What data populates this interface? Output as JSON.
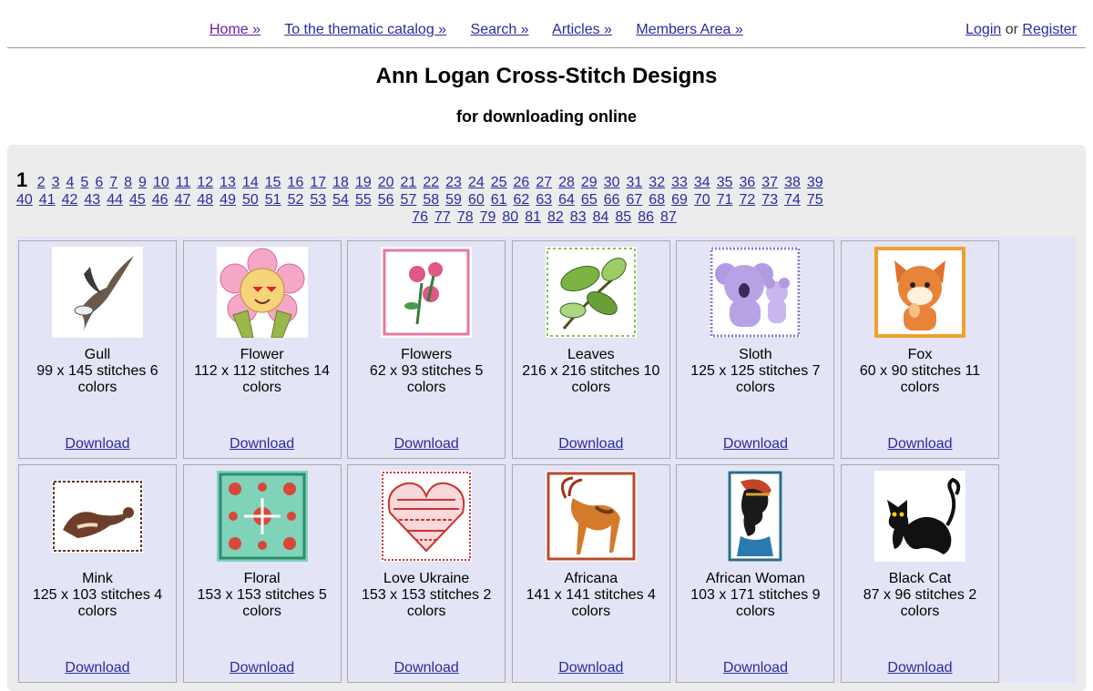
{
  "nav": {
    "home": "Home »",
    "catalog": "To the thematic catalog »",
    "search": "Search »",
    "articles": "Articles »",
    "members": "Members Area »",
    "login": "Login",
    "or": "or",
    "register": "Register"
  },
  "header": {
    "title": "Ann Logan Cross-Stitch Designs",
    "subtitle": "for downloading online"
  },
  "pager": {
    "current": "1",
    "pages_row1": [
      "2",
      "3",
      "4",
      "5",
      "6",
      "7",
      "8",
      "9",
      "10",
      "11",
      "12",
      "13",
      "14",
      "15",
      "16",
      "17",
      "18",
      "19",
      "20",
      "21",
      "22",
      "23",
      "24",
      "25",
      "26",
      "27",
      "28",
      "29",
      "30",
      "31",
      "32",
      "33",
      "34",
      "35",
      "36",
      "37",
      "38",
      "39"
    ],
    "pages_row2": [
      "40",
      "41",
      "42",
      "43",
      "44",
      "45",
      "46",
      "47",
      "48",
      "49",
      "50",
      "51",
      "52",
      "53",
      "54",
      "55",
      "56",
      "57",
      "58",
      "59",
      "60",
      "61",
      "62",
      "63",
      "64",
      "65",
      "66",
      "67",
      "68",
      "69",
      "70",
      "71",
      "72",
      "73",
      "74",
      "75"
    ],
    "pages_row3": [
      "76",
      "77",
      "78",
      "79",
      "80",
      "81",
      "82",
      "83",
      "84",
      "85",
      "86",
      "87"
    ]
  },
  "download_label": "Download",
  "designs": [
    {
      "name": "Gull",
      "info": "99 x 145 stitches 6 colors",
      "icon": "gull-icon"
    },
    {
      "name": "Flower",
      "info": "112 x 112 stitches 14 colors",
      "icon": "flower-icon"
    },
    {
      "name": "Flowers",
      "info": "62 x 93 stitches 5 colors",
      "icon": "flowers-icon"
    },
    {
      "name": "Leaves",
      "info": "216 x 216 stitches 10 colors",
      "icon": "leaves-icon"
    },
    {
      "name": "Sloth",
      "info": "125 x 125 stitches 7 colors",
      "icon": "koala-icon"
    },
    {
      "name": "Fox",
      "info": "60 x 90 stitches 11 colors",
      "icon": "fox-icon"
    },
    {
      "name": "Mink",
      "info": "125 x 103 stitches 4 colors",
      "icon": "mink-icon"
    },
    {
      "name": "Floral",
      "info": "153 x 153 stitches 5 colors",
      "icon": "floral-icon"
    },
    {
      "name": "Love Ukraine",
      "info": "153 x 153 stitches 2 colors",
      "icon": "heart-icon"
    },
    {
      "name": "Africana",
      "info": "141 x 141 stitches 4 colors",
      "icon": "antelope-icon"
    },
    {
      "name": "African Woman",
      "info": "103 x 171 stitches 9 colors",
      "icon": "woman-icon"
    },
    {
      "name": "Black Cat",
      "info": "87 x 96 stitches 2 colors",
      "icon": "cat-icon"
    }
  ]
}
